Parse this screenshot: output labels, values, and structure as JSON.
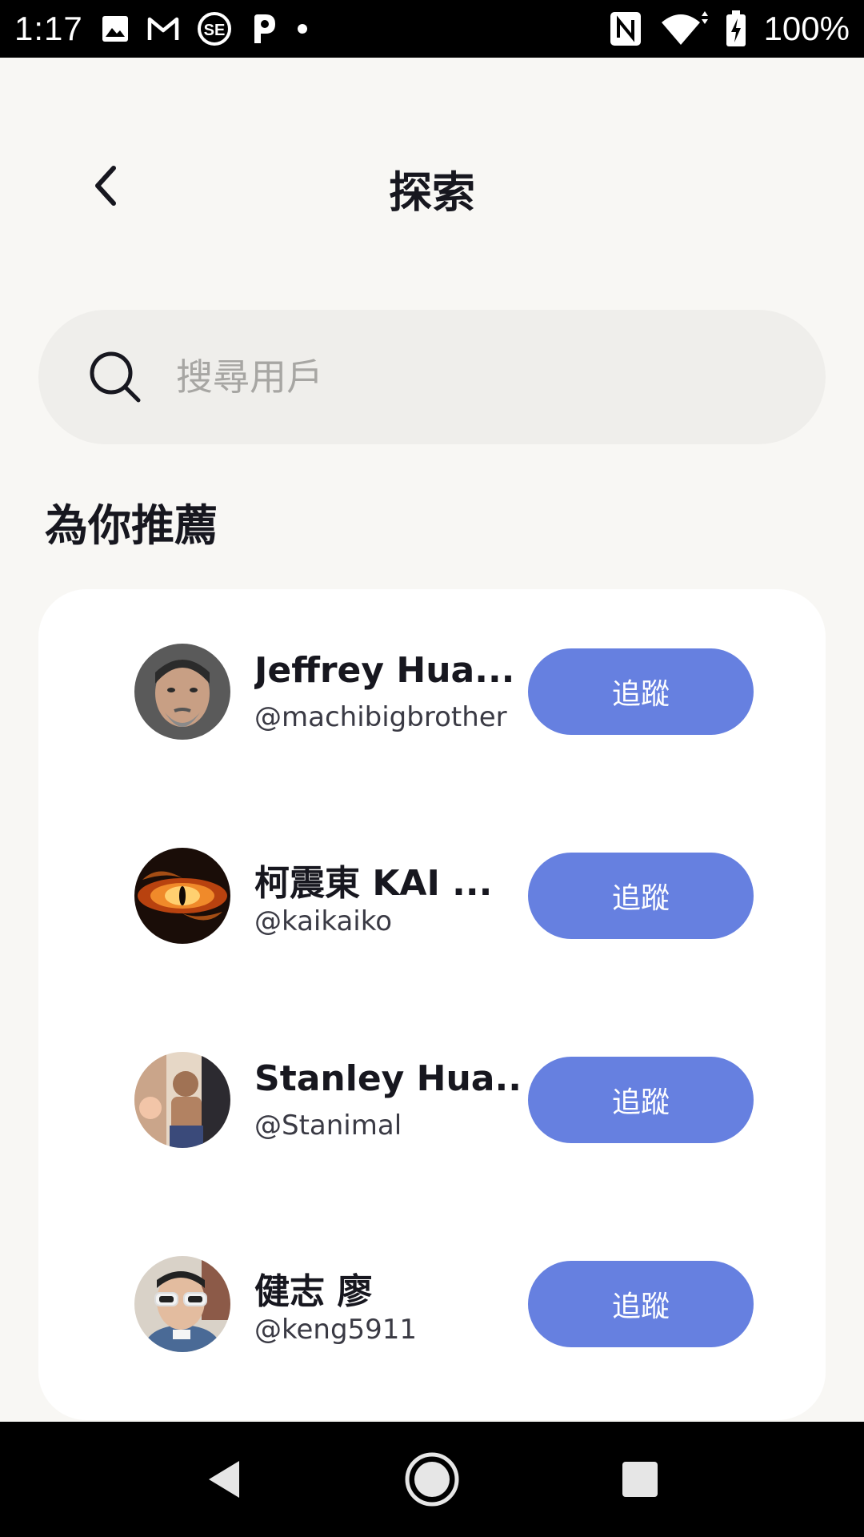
{
  "status_bar": {
    "time": "1:17",
    "battery": "100%",
    "left_icons": [
      "image-icon",
      "gmail-icon",
      "sf-icon",
      "p-icon",
      "dot-icon"
    ],
    "right_icons": [
      "nfc-icon",
      "wifi-icon",
      "battery-icon"
    ]
  },
  "header": {
    "title": "探索"
  },
  "search": {
    "placeholder": "搜尋用戶",
    "value": ""
  },
  "section": {
    "title": "為你推薦"
  },
  "users": [
    {
      "name": "Jeffrey Hua...",
      "handle": "@machibigbrother",
      "button": "追蹤",
      "avatar": "avatar-man-beard"
    },
    {
      "name": "柯震東 KAI ...",
      "handle": "@kaikaiko",
      "button": "追蹤",
      "avatar": "avatar-fire-eye"
    },
    {
      "name": "Stanley Hua...",
      "handle": "@Stanimal",
      "button": "追蹤",
      "avatar": "avatar-photo-child"
    },
    {
      "name": "健志 廖",
      "handle": "@keng5911",
      "button": "追蹤",
      "avatar": "avatar-sunglasses"
    }
  ],
  "colors": {
    "background": "#f8f7f4",
    "accent": "#6680e0",
    "search_bg": "#efeeeb",
    "card_bg": "#ffffff"
  }
}
